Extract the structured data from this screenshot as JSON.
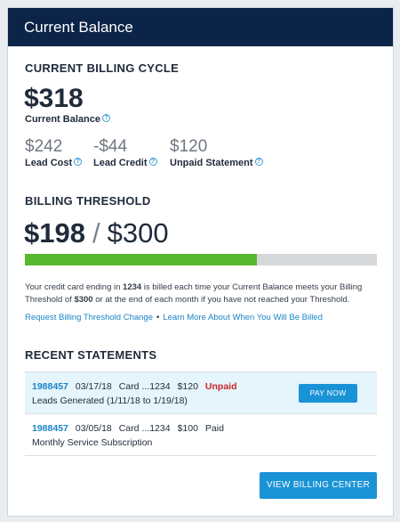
{
  "header": {
    "title": "Current Balance"
  },
  "billing_cycle": {
    "section_title": "CURRENT BILLING CYCLE",
    "current_balance": "$318",
    "current_balance_label": "Current Balance",
    "lead_cost": "$242",
    "lead_cost_label": "Lead Cost",
    "lead_credit": "-$44",
    "lead_credit_label": "Lead Credit",
    "unpaid_statement": "$120",
    "unpaid_statement_label": "Unpaid Statement"
  },
  "threshold": {
    "section_title": "BILLING THRESHOLD",
    "current": "$198",
    "separator": "/",
    "limit": "$300",
    "progress_fraction": 0.66,
    "description_part1": "Your credit card ending in ",
    "card_last4": "1234",
    "description_part2": " is billed each time your Current Balance meets your Billing Threshold of ",
    "threshold_amount": "$300",
    "description_part3": " or at the end of each month if you have not reached your Threshold.",
    "link_change": "Request Billing Threshold Change",
    "link_dot": "•",
    "link_learn": "Learn More About When You Will Be Billed"
  },
  "statements": {
    "section_title": "RECENT STATEMENTS",
    "rows": [
      {
        "id": "1988457",
        "date": "03/17/18",
        "card": "Card ...1234",
        "amount": "$120",
        "status": "Unpaid",
        "description": "Leads Generated (1/11/18 to 1/19/18)",
        "action": "PAY NOW"
      },
      {
        "id": "1988457",
        "date": "03/05/18",
        "card": "Card ...1234",
        "amount": "$100",
        "status": "Paid",
        "description": "Monthly Service  Subscription"
      }
    ]
  },
  "footer": {
    "button_label": "VIEW BILLING CENTER"
  },
  "colors": {
    "header_bg": "#0b2447",
    "accent_blue": "#1a93d6",
    "progress_green": "#58b82f",
    "unpaid_red": "#c62828"
  },
  "icons": {
    "help": "question-circle-icon"
  }
}
